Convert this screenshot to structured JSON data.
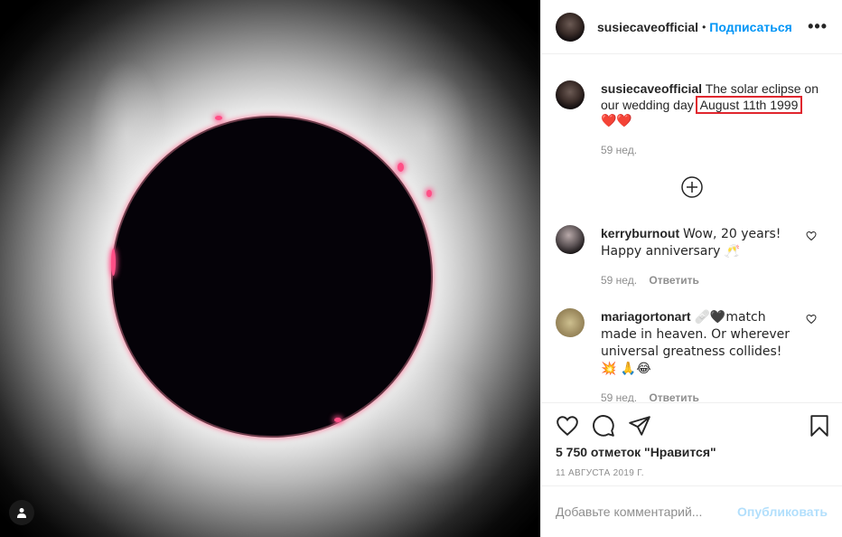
{
  "post": {
    "username": "susiecaveofficial",
    "follow_label": "Подписаться",
    "more_label": "•••",
    "caption_before": "The solar eclipse on our wedding day",
    "caption_highlight": "August 11th 1999",
    "caption_emoji": "❤️❤️",
    "caption_time": "59 нед."
  },
  "comments": [
    {
      "username": "kerryburnout",
      "text": "Wow, 20 years! Happy anniversary 🥂",
      "time": "59 нед.",
      "reply_label": "Ответить"
    },
    {
      "username": "mariagortonart",
      "text": "🩹🖤match made in heaven. Or wherever universal greatness collides! 💥 🙏😂",
      "time": "59 нед.",
      "reply_label": "Ответить"
    }
  ],
  "stats": {
    "likes": "5 750 отметок \"Нравится\"",
    "date": "11 АВГУСТА 2019 Г."
  },
  "composer": {
    "placeholder": "Добавьте комментарий...",
    "post_label": "Опубликовать"
  },
  "colors": {
    "accent": "#0095f6",
    "highlight_box": "#e0262e",
    "heart": "#ed4956"
  }
}
